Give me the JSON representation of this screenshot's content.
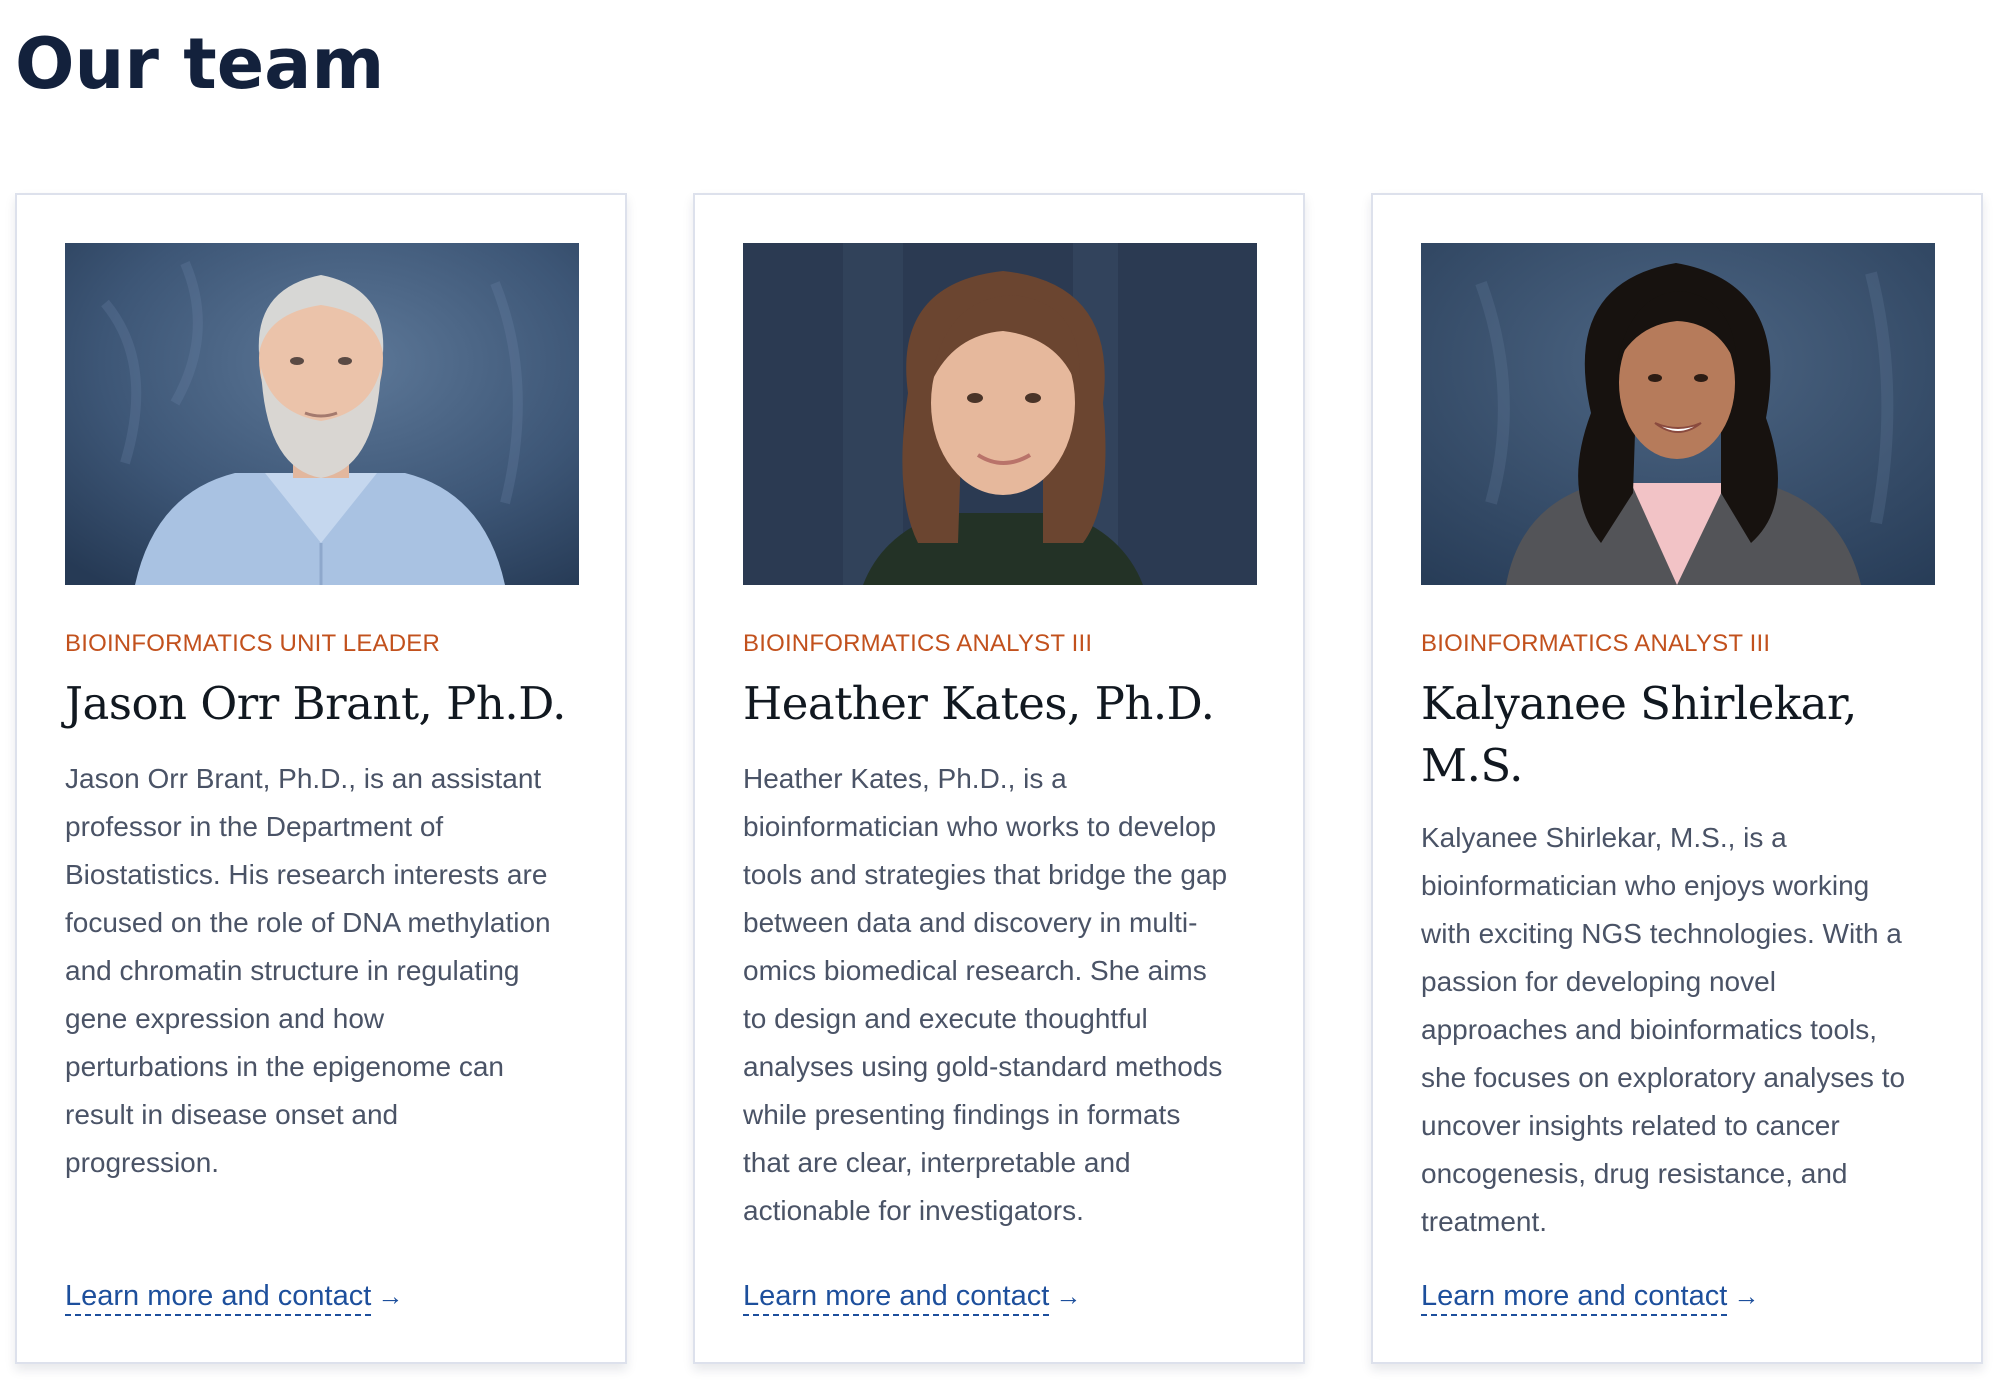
{
  "page": {
    "title": "Our team"
  },
  "members": [
    {
      "role": "BIOINFORMATICS UNIT LEADER",
      "name": "Jason Orr Brant, Ph.D.",
      "bio_lines": [
        "Jason Orr Brant, Ph.D., is an assistant",
        "professor in the Department of",
        "Biostatistics. His research interests are",
        "focused on the role of DNA methylation",
        "and chromatin structure in regulating",
        "gene expression and how",
        "perturbations in the epigenome can",
        "result in disease onset and",
        "progression."
      ],
      "link": "Learn more and contact",
      "photo_description": "portrait-older-man-grey-beard-blue-shirt"
    },
    {
      "role": "BIOINFORMATICS ANALYST III",
      "name": "Heather Kates, Ph.D.",
      "bio_lines": [
        "Heather Kates, Ph.D., is a",
        "bioinformatician who works to develop",
        "tools and strategies that bridge the gap",
        "between data and discovery in multi-",
        "omics biomedical research. She aims",
        "to design and execute thoughtful",
        "analyses using gold-standard methods",
        "while presenting findings in formats",
        "that are clear, interpretable and",
        "actionable for investigators."
      ],
      "link": "Learn more and contact",
      "photo_description": "portrait-woman-brown-hair-dark-top"
    },
    {
      "role": "BIOINFORMATICS ANALYST III",
      "name_lines": [
        "Kalyanee Shirlekar,",
        "M.S."
      ],
      "bio_lines": [
        "Kalyanee Shirlekar, M.S., is a",
        "bioinformatician who enjoys working",
        "with exciting NGS technologies. With a",
        "passion for developing novel",
        "approaches and bioinformatics tools,",
        "she focuses on exploratory analyses to",
        "uncover insights related to cancer",
        "oncogenesis, drug resistance, and",
        "treatment."
      ],
      "link": "Learn more and contact",
      "photo_description": "portrait-woman-curly-black-hair-grey-blazer"
    }
  ],
  "colors": {
    "title": "#13213c",
    "role": "#c2511d",
    "name": "#111820",
    "body": "#4a5366",
    "link": "#1d4f9c",
    "card_border": "#dde1ec",
    "photo_background": "#2f4763"
  },
  "icons": {
    "link_arrow": "arrow-right-icon"
  }
}
